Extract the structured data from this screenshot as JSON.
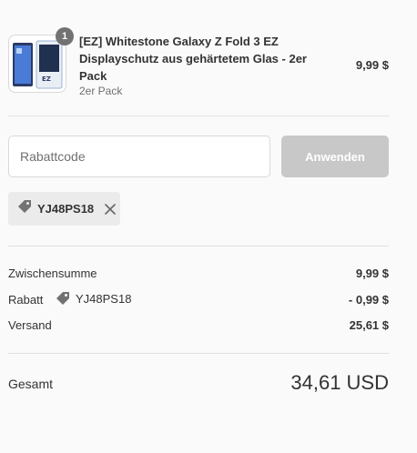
{
  "product": {
    "quantity": "1",
    "title": "[EZ] Whitestone Galaxy Z Fold 3 EZ Displayschutz aus gehärtetem Glas - 2er Pack",
    "variant": "2er Pack",
    "price": "9,99 $"
  },
  "discount": {
    "placeholder": "Rabattcode",
    "apply_label": "Anwenden",
    "applied_code": "YJ48PS18"
  },
  "summary": {
    "subtotal_label": "Zwischensumme",
    "subtotal_value": "9,99 $",
    "discount_label": "Rabatt",
    "discount_code": "YJ48PS18",
    "discount_value": "- 0,99 $",
    "shipping_label": "Versand",
    "shipping_value": "25,61 $",
    "total_label": "Gesamt",
    "total_value": "34,61 USD"
  },
  "icons": {
    "tag": "tag-icon",
    "remove": "close-icon"
  },
  "colors": {
    "apply_button_bg": "#c8c8c8",
    "chip_bg": "#ebebeb",
    "badge_bg": "#727272"
  }
}
